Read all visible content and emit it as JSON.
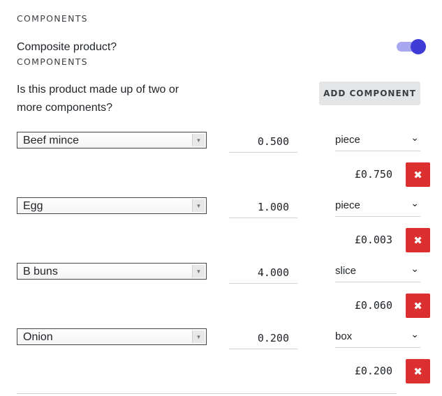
{
  "section_title": "COMPONENTS",
  "composite": {
    "label": "Composite product?",
    "enabled": true,
    "sub_title": "COMPONENTS",
    "question": [
      "Is this product made up of two or",
      "more components?"
    ]
  },
  "add_button_label": "ADD COMPONENT",
  "components": [
    {
      "name": "Beef mince",
      "quantity": "0.500",
      "unit": "piece",
      "price": "£0.750"
    },
    {
      "name": "Egg",
      "quantity": "1.000",
      "unit": "piece",
      "price": "£0.003"
    },
    {
      "name": "B buns",
      "quantity": "4.000",
      "unit": "slice",
      "price": "£0.060"
    },
    {
      "name": "Onion",
      "quantity": "0.200",
      "unit": "box",
      "price": "£0.200"
    }
  ],
  "icons": {
    "dropdown": "triangle-down-icon",
    "chevron": "chevron-down-icon",
    "delete": "close-x-icon"
  },
  "colors": {
    "toggle_knob": "#3f3bd6",
    "toggle_track": "#a9a7ef",
    "delete_button": "#dc2f2f",
    "add_button_bg": "#e4e5e7"
  }
}
